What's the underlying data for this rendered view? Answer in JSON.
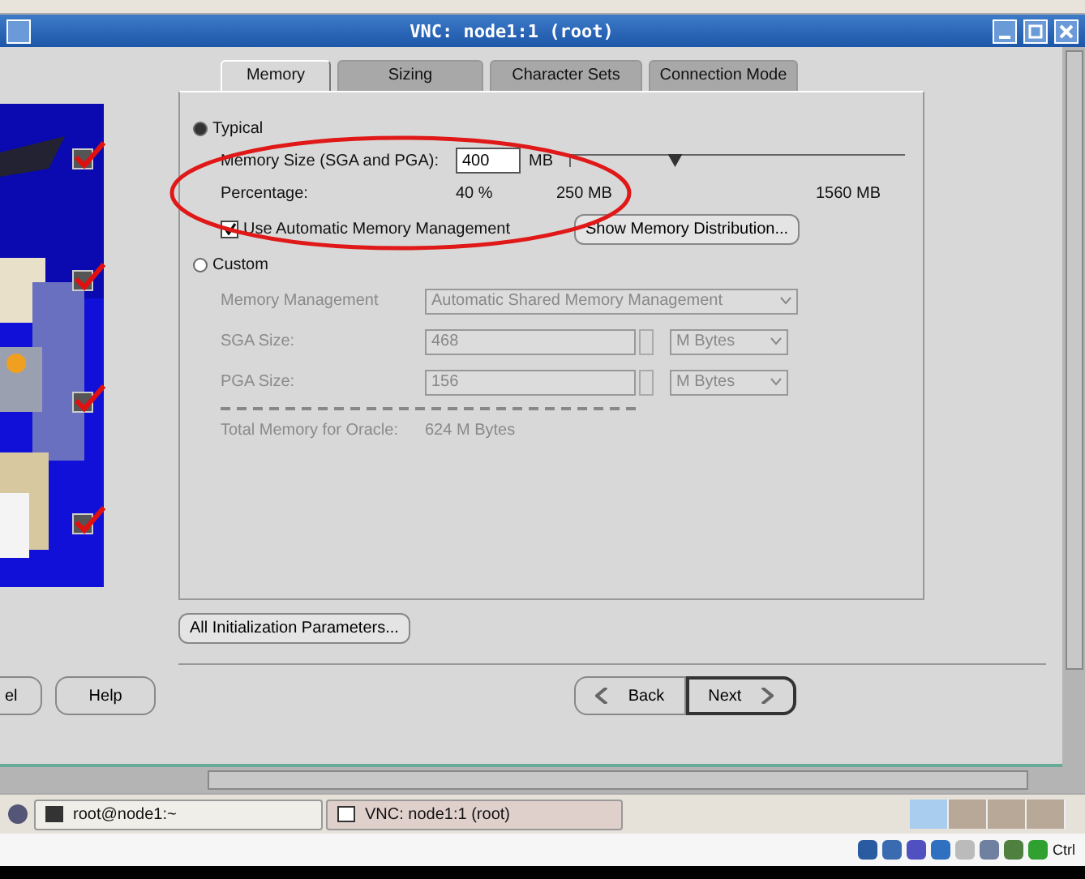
{
  "window": {
    "title": "VNC: node1:1 (root)"
  },
  "steps": [
    {
      "checked": true
    },
    {
      "checked": true
    },
    {
      "checked": true
    },
    {
      "checked": true
    }
  ],
  "tabs": [
    {
      "label": "Memory",
      "selected": true
    },
    {
      "label": "Sizing",
      "selected": false
    },
    {
      "label": "Character Sets",
      "selected": false
    },
    {
      "label": "Connection Mode",
      "selected": false
    }
  ],
  "typical": {
    "label": "Typical",
    "selected": true,
    "memory_size_label": "Memory Size (SGA and PGA):",
    "memory_size_value": "400",
    "unit": "MB",
    "slider": {
      "level": 0.29
    },
    "percentage_label": "Percentage:",
    "percentage_value": "40 %",
    "slider_min": "250 MB",
    "slider_max": "1560 MB",
    "auto_memory": {
      "label": "Use Automatic Memory Management",
      "checked": true
    },
    "show_button": "Show Memory Distribution..."
  },
  "custom": {
    "label": "Custom",
    "selected": false,
    "disabled": true,
    "management_label": "Memory Management",
    "management_value": "Automatic Shared Memory Management",
    "sga_label": "SGA Size:",
    "sga_value": "468",
    "sga_unit": "M Bytes",
    "pga_label": "PGA Size:",
    "pga_value": "156",
    "pga_unit": "M Bytes",
    "total_label": "Total Memory for Oracle:",
    "total_value": "624 M Bytes"
  },
  "all_parameters_button": "All Initialization Parameters...",
  "buttons": [
    {
      "label": "el",
      "kind": "plain"
    },
    {
      "label": "Help",
      "kind": "plain"
    },
    {
      "label": "Back",
      "kind": "back"
    },
    {
      "label": "Next",
      "kind": "next"
    }
  ],
  "taskbar": [
    {
      "label": "root@node1:~",
      "selected": false
    },
    {
      "label": "VNC: node1:1 (root)",
      "selected": true
    }
  ],
  "workspaces": [
    {
      "selected": true
    },
    {
      "selected": false
    },
    {
      "selected": false
    },
    {
      "selected": false
    }
  ],
  "tray": {
    "label": "Ctrl"
  }
}
